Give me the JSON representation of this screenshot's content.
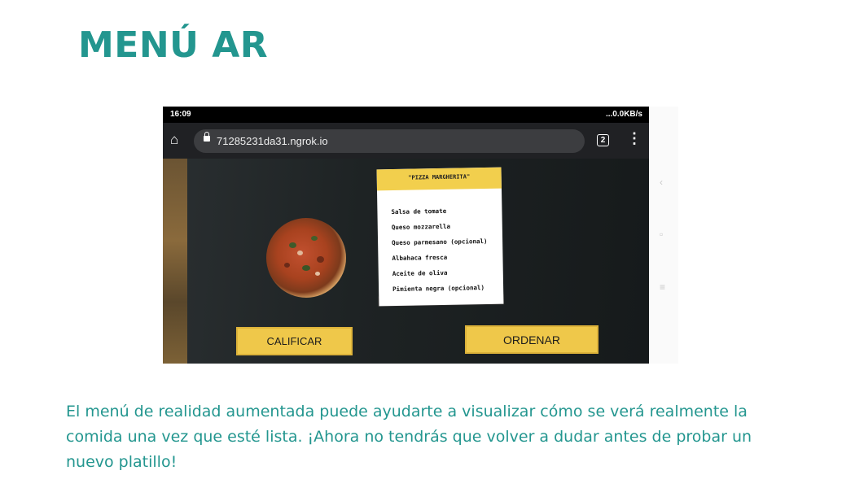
{
  "page": {
    "title": "MENÚ AR",
    "caption": "El menú de realidad aumentada puede ayudarte a visualizar cómo se verá realmente la comida una vez que esté lista. ¡Ahora no tendrás que volver a dudar antes de probar un nuevo platillo!",
    "accent_color": "#23968f"
  },
  "phone": {
    "status_time": "16:09",
    "status_right": "...0.0KB/s",
    "url": "71285231da31.ngrok.io",
    "tab_count": "2",
    "icons": [
      "home-icon",
      "lock-icon",
      "more-icon",
      "back-icon",
      "recent-apps-icon",
      "menu-icon"
    ]
  },
  "ar_card": {
    "title": "\"PIZZA MARGHERITA\"",
    "ingredients": [
      "Salsa de tomate",
      "Queso mozzarella",
      "Queso parmesano (opcional)",
      "Albahaca fresca",
      "Aceite de oliva",
      "Pimienta negra (opcional)"
    ],
    "header_color": "#f2cf4d"
  },
  "buttons": {
    "calificar": "CALIFICAR",
    "ordenar": "ORDENAR",
    "color": "#efc84a"
  }
}
